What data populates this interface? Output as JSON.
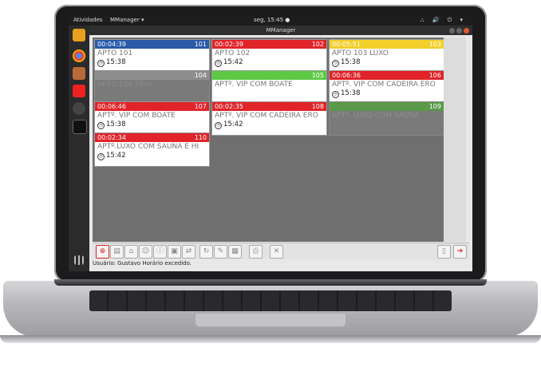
{
  "topbar": {
    "activities": "Atividades",
    "app_menu": "MManager ▾",
    "clock": "seg, 15:45 ●",
    "tray": "⛬ 🔊 ⏻ ▾"
  },
  "window": {
    "title": "MManager"
  },
  "rooms": [
    {
      "timer": "00:04:39",
      "number": "101",
      "name": "APTO 101",
      "time": "15:38",
      "color": "#2a5aa8",
      "empty": false
    },
    {
      "timer": "00:02:39",
      "number": "102",
      "name": "APTO 102",
      "time": "15:42",
      "color": "#e0242a",
      "empty": false
    },
    {
      "timer": "00:05:51",
      "number": "103",
      "name": "APTO 103 LUXO",
      "time": "15:38",
      "color": "#f3cf2a",
      "empty": false
    },
    {
      "timer": "",
      "number": "104",
      "name": "APTO 104 REAL",
      "time": "",
      "color": "#8e8e8e",
      "empty": true
    },
    {
      "timer": "",
      "number": "105",
      "name": "APTº. VIP COM BOATE",
      "time": "",
      "color": "#5dc945",
      "empty": false
    },
    {
      "timer": "00:06:36",
      "number": "106",
      "name": "APTº. VIP COM CADEIRA ERO",
      "time": "15:38",
      "color": "#e0242a",
      "empty": false
    },
    {
      "timer": "00:06:46",
      "number": "107",
      "name": "APTº. VIP COM BOATE",
      "time": "15:38",
      "color": "#e0242a",
      "empty": false
    },
    {
      "timer": "00:02:35",
      "number": "108",
      "name": "APTº. VIP COM CADEIRA ERO",
      "time": "15:42",
      "color": "#e0242a",
      "empty": false
    },
    {
      "timer": "",
      "number": "109",
      "name": "APTº. LUXO COM SAUNA",
      "time": "",
      "color": "#5a9a4a",
      "empty": true
    },
    {
      "timer": "00:02:34",
      "number": "110",
      "name": "APTº.LUXO COM SAUNA E HI",
      "time": "15:42",
      "color": "#e0242a",
      "empty": false
    }
  ],
  "status": {
    "text": "Usuário: Gustavo  Horário excedido."
  }
}
